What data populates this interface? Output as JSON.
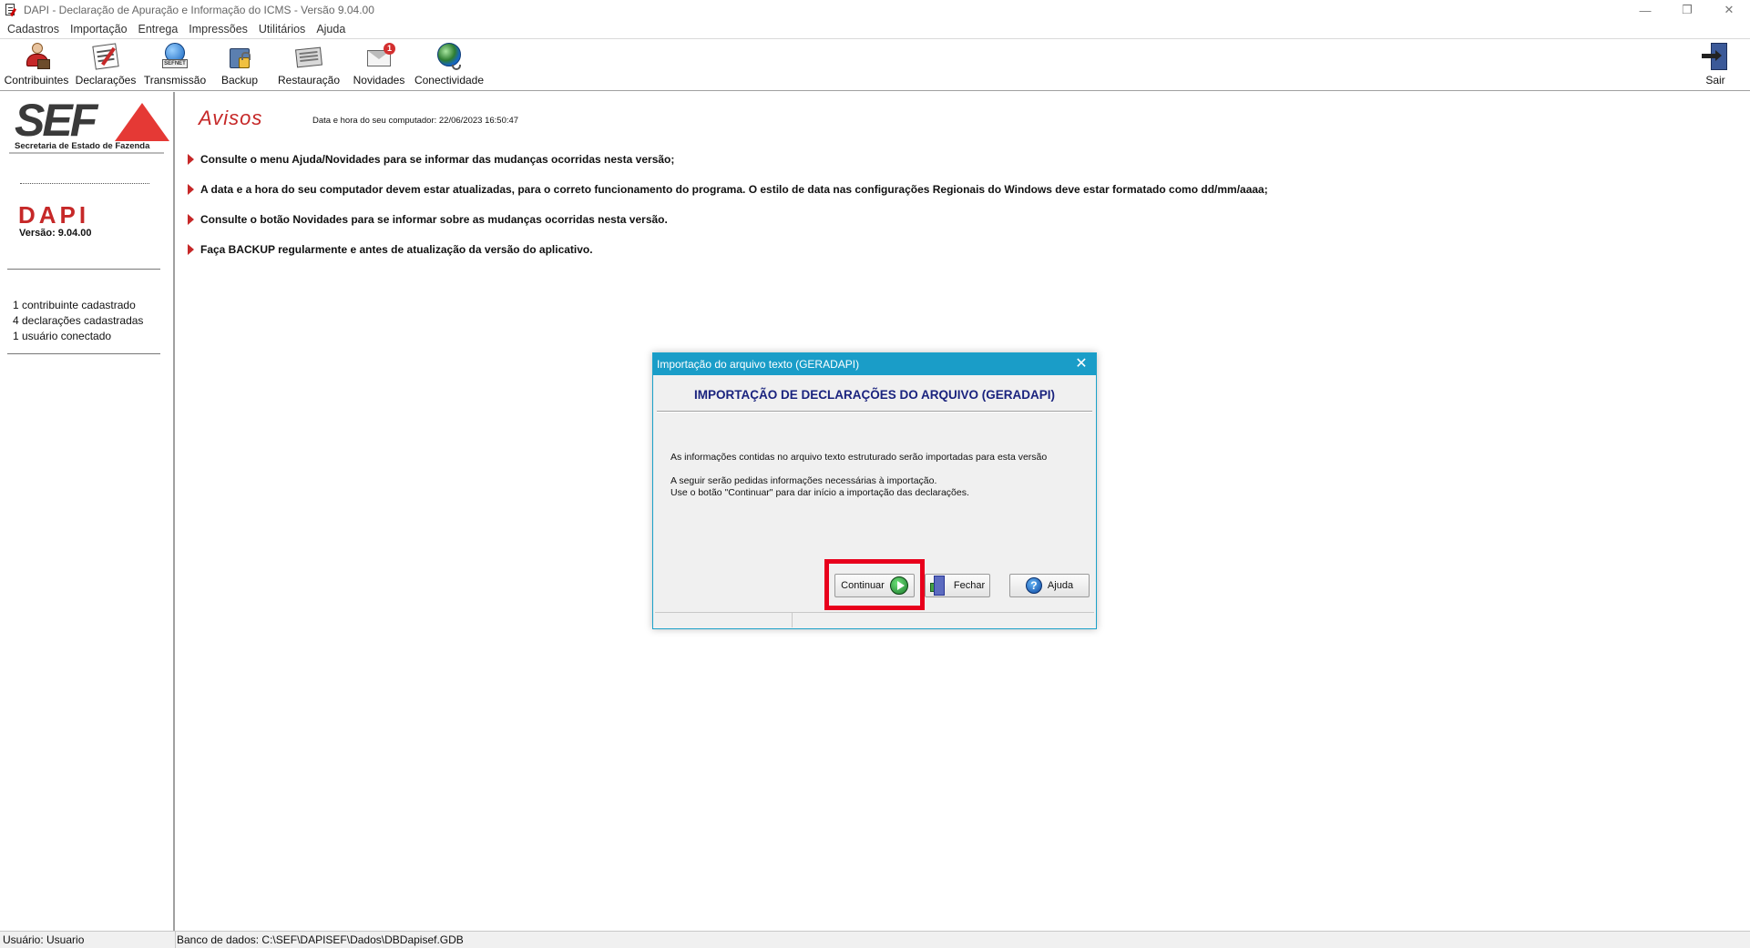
{
  "window": {
    "title": "DAPI - Declaração de Apuração e Informação do ICMS - Versão 9.04.00",
    "controls": {
      "minimize": "—",
      "restore": "❐",
      "close": "✕"
    }
  },
  "menu": {
    "items": [
      {
        "label": "Cadastros"
      },
      {
        "label": "Importação"
      },
      {
        "label": "Entrega"
      },
      {
        "label": "Impressões"
      },
      {
        "label": "Utilitários"
      },
      {
        "label": "Ajuda"
      }
    ]
  },
  "toolbar": {
    "contribuintes": "Contribuintes",
    "declaracoes": "Declarações",
    "transmissao": "Transmissão",
    "transmissao_plate": "SEFNET",
    "backup": "Backup",
    "restauracao": "Restauração",
    "novidades": "Novidades",
    "novidades_badge": "1",
    "conectividade": "Conectividade",
    "sair": "Sair"
  },
  "sidebar": {
    "logo_letters": "SEF",
    "logo_subtitle": "Secretaria de Estado de Fazenda",
    "app_name": "DAPI",
    "version": "Versão: 9.04.00",
    "stats": [
      "1 contribuinte cadastrado",
      "4 declarações cadastradas",
      "1 usuário conectado"
    ]
  },
  "main": {
    "title": "Avisos",
    "datetime": "Data e hora do seu computador: 22/06/2023 16:50:47",
    "notices": [
      "Consulte o menu Ajuda/Novidades para se informar das mudanças ocorridas nesta versão;",
      "A data e a hora do seu computador devem estar atualizadas, para o correto funcionamento do programa. O estilo de data nas configurações Regionais do Windows deve estar formatado como dd/mm/aaaa;",
      "Consulte o botão Novidades para se informar sobre as mudanças ocorridas nesta versão.",
      "Faça BACKUP regularmente e antes de atualização da versão do aplicativo."
    ]
  },
  "dialog": {
    "title": "Importação do arquivo texto (GERADAPI)",
    "heading": "IMPORTAÇÃO DE DECLARAÇÕES DO ARQUIVO (GERADAPI)",
    "line1": "As informações contidas no arquivo texto estruturado serão importadas para esta versão",
    "line2": "A seguir serão pedidas informações necessárias à importação.",
    "line3": "Use o botão \"Continuar\" para dar início a importação das declarações.",
    "continuar": "Continuar",
    "fechar": "Fechar",
    "ajuda": "Ajuda",
    "help_glyph": "?",
    "close_glyph": "✕"
  },
  "statusbar": {
    "user": "Usuário: Usuario",
    "database": "Banco de dados: C:\\SEF\\DAPISEF\\Dados\\DBDapisef.GDB"
  },
  "colors": {
    "accent_red": "#c62828",
    "dialog_titlebar": "#1a9dc8",
    "highlight_box": "#e8001c",
    "heading_navy": "#1a237e"
  }
}
